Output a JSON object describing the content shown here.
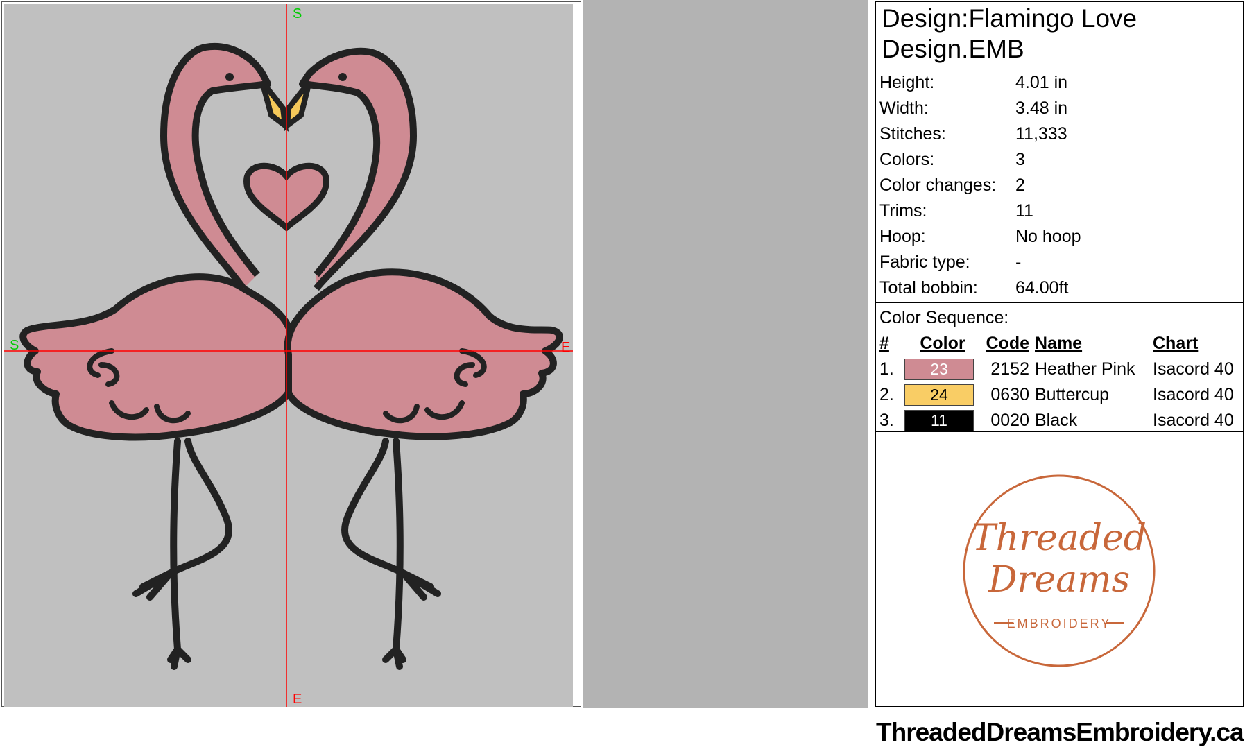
{
  "canvas": {
    "axis_labels": {
      "top": "S",
      "left": "S",
      "right": "E",
      "bottom": "E"
    },
    "colors": {
      "hoop_background": "#c0c0c0",
      "crosshair": "#ff0000",
      "start_marker": "#00cc00",
      "end_marker": "#ff0000",
      "pink_fill": "#cf8b93",
      "beak_fill": "#f5c85a",
      "outline": "#222222"
    }
  },
  "info": {
    "design_title": "Design:Flamingo Love",
    "file_name": "Design.EMB",
    "properties": [
      {
        "label": "Height:",
        "value": "4.01 in"
      },
      {
        "label": "Width:",
        "value": "3.48 in"
      },
      {
        "label": "Stitches:",
        "value": "11,333"
      },
      {
        "label": "Colors:",
        "value": "3"
      },
      {
        "label": "Color changes:",
        "value": "2"
      },
      {
        "label": "Trims:",
        "value": "11"
      },
      {
        "label": "Hoop:",
        "value": "No hoop"
      },
      {
        "label": "Fabric type:",
        "value": "-"
      },
      {
        "label": "Total bobbin:",
        "value": "64.00ft"
      }
    ],
    "color_sequence_title": "Color Sequence:",
    "table_headers": {
      "num": "#",
      "color": "Color",
      "code": "Code",
      "name": "Name",
      "chart": "Chart"
    },
    "color_rows": [
      {
        "num": "1.",
        "swatch_label": "23",
        "swatch_color": "#cf8b93",
        "text_color": "#ffffff",
        "code": "2152",
        "name": "Heather Pink",
        "chart": "Isacord 40"
      },
      {
        "num": "2.",
        "swatch_label": "24",
        "swatch_color": "#f9cd65",
        "text_color": "#000000",
        "code": "0630",
        "name": "Buttercup",
        "chart": "Isacord 40"
      },
      {
        "num": "3.",
        "swatch_label": "11",
        "swatch_color": "#000000",
        "text_color": "#ffffff",
        "code": "0020",
        "name": "Black",
        "chart": "Isacord 40"
      }
    ]
  },
  "logo": {
    "script_line1": "Threaded",
    "script_line2": "Dreams",
    "tagline": "EMBROIDERY",
    "accent_color": "#c8673a",
    "website": "ThreadedDreamsEmbroidery.ca"
  }
}
